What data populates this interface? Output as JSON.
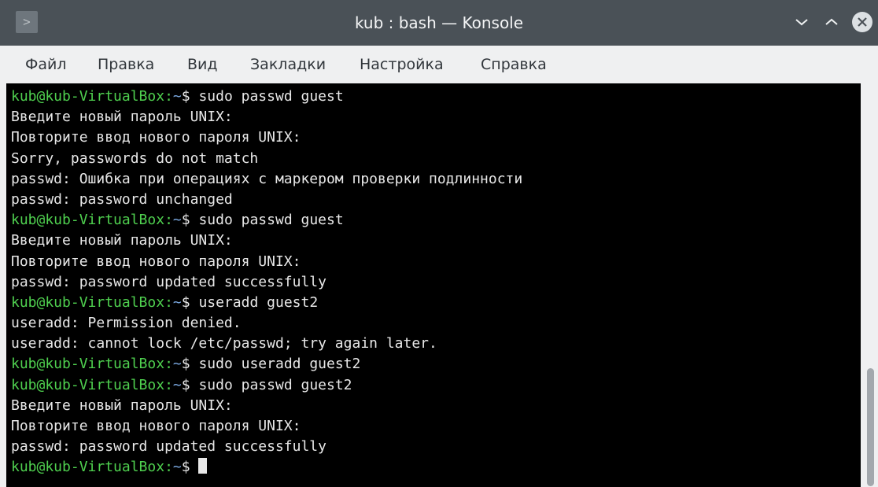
{
  "window": {
    "title": "kub : bash — Konsole",
    "icons": {
      "app": "terminal-icon",
      "minimize": "chevron-down-icon",
      "maximize": "chevron-up-icon",
      "close": "close-icon"
    }
  },
  "menu": {
    "items": [
      "Файл",
      "Правка",
      "Вид",
      "Закладки",
      "Настройка",
      "Справка"
    ]
  },
  "terminal": {
    "prompt_user": "kub@kub-VirtualBox",
    "prompt_sep": ":",
    "prompt_dir": "~",
    "prompt_symbol": "$",
    "lines": [
      {
        "type": "cmd",
        "text": "sudo passwd guest"
      },
      {
        "type": "out",
        "text": "Введите новый пароль UNIX:"
      },
      {
        "type": "out",
        "text": "Повторите ввод нового пароля UNIX:"
      },
      {
        "type": "out",
        "text": "Sorry, passwords do not match"
      },
      {
        "type": "out",
        "text": "passwd: Ошибка при операциях с маркером проверки подлинности"
      },
      {
        "type": "out",
        "text": "passwd: password unchanged"
      },
      {
        "type": "cmd",
        "text": "sudo passwd guest"
      },
      {
        "type": "out",
        "text": "Введите новый пароль UNIX:"
      },
      {
        "type": "out",
        "text": "Повторите ввод нового пароля UNIX:"
      },
      {
        "type": "out",
        "text": "passwd: password updated successfully"
      },
      {
        "type": "cmd",
        "text": "useradd guest2"
      },
      {
        "type": "out",
        "text": "useradd: Permission denied."
      },
      {
        "type": "out",
        "text": "useradd: cannot lock /etc/passwd; try again later."
      },
      {
        "type": "cmd",
        "text": "sudo useradd guest2"
      },
      {
        "type": "cmd",
        "text": "sudo passwd guest2"
      },
      {
        "type": "out",
        "text": "Введите новый пароль UNIX:"
      },
      {
        "type": "out",
        "text": "Повторите ввод нового пароля UNIX:"
      },
      {
        "type": "out",
        "text": "passwd: password updated successfully"
      },
      {
        "type": "cmd",
        "text": "",
        "cursor": true
      }
    ]
  },
  "colors": {
    "titlebar": "#4a5157",
    "terminal_bg": "#000000",
    "prompt": "#4fd04f",
    "directory": "#7aa8e0",
    "text": "#e8e8e8"
  }
}
